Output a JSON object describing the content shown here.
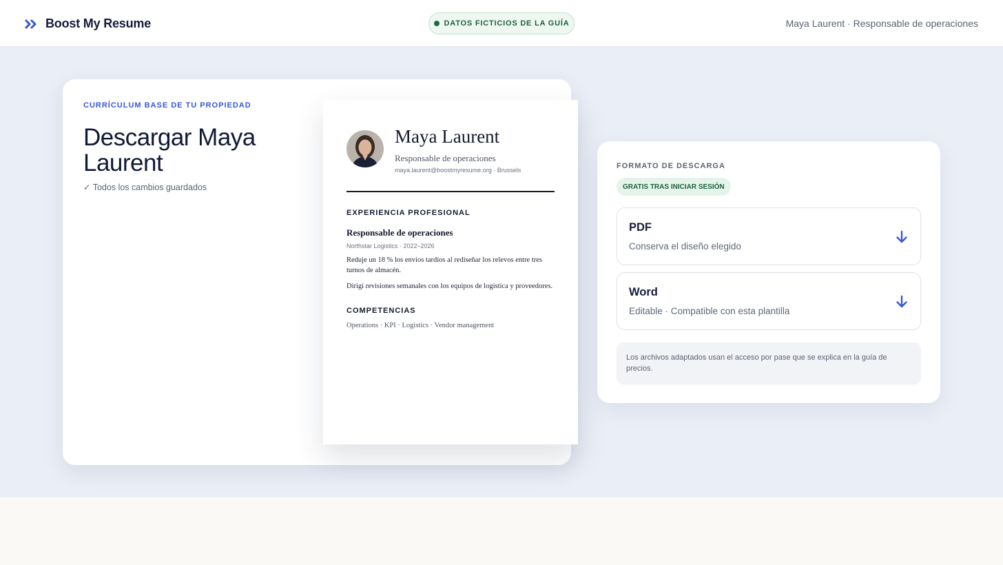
{
  "header": {
    "brand_name": "Boost My Resume",
    "brand_icon": "double-chevron-right-icon",
    "badge": "DATOS FICTICIOS DE LA GUÍA",
    "user_info": "Maya Laurent · Responsable de operaciones"
  },
  "editor": {
    "eyebrow": "CURRÍCULUM BASE DE TU PROPIEDAD",
    "title": "Descargar Maya Laurent",
    "saved_status": "✓ Todos los cambios guardados"
  },
  "resume": {
    "name": "Maya Laurent",
    "role": "Responsable de operaciones",
    "contact": "maya.laurent@boostmyresume.org · Brussels",
    "experience_heading": "EXPERIENCIA PROFESIONAL",
    "job_title": "Responsable de operaciones",
    "job_meta": "Northstar Logistics · 2022–2026",
    "bullets": [
      "Reduje un 18 % los envíos tardíos al rediseñar los relevos entre tres turnos de almacén.",
      "Dirigí revisiones semanales con los equipos de logística y proveedores."
    ],
    "skills_heading": "COMPETENCIAS",
    "skills": "Operations · KPI · Logistics · Vendor management"
  },
  "download": {
    "label": "FORMATO DE DESCARGA",
    "badge": "GRATIS TRAS INICIAR SESIÓN",
    "options": [
      {
        "title": "PDF",
        "subtitle": "Conserva el diseño elegido",
        "icon": "arrow-down-icon"
      },
      {
        "title": "Word",
        "subtitle": "Editable · Compatible con esta plantilla",
        "icon": "arrow-down-icon"
      }
    ],
    "note": "Los archivos adaptados usan el acceso por pase que se explica en la guía de precios."
  },
  "colors": {
    "accent": "#3657d6",
    "green": "#1f5f3b",
    "stage_bg": "#eaeef6"
  }
}
